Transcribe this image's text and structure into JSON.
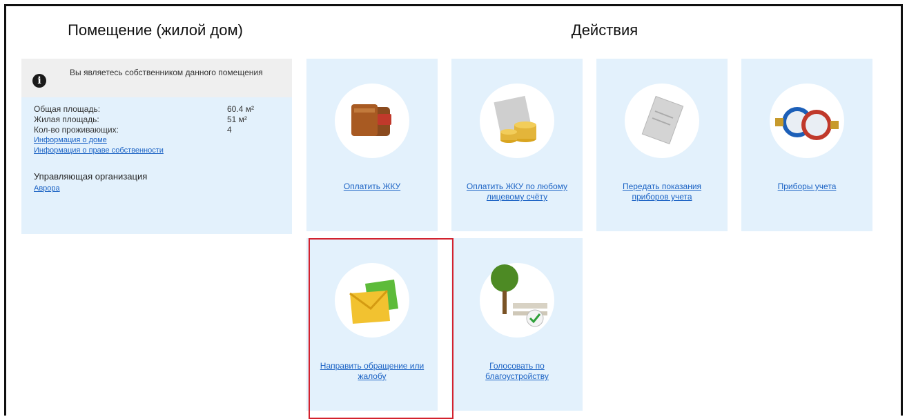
{
  "left_section": {
    "title": "Помещение (жилой дом)",
    "notice": "Вы являетесь собственником данного помещения",
    "properties": [
      {
        "label": "Общая площадь:",
        "value": "60.4 м²"
      },
      {
        "label": "Жилая площадь:",
        "value": "51 м²"
      },
      {
        "label": "Кол-во проживающих:",
        "value": "4"
      }
    ],
    "links": [
      "Информация о доме",
      "Информация о праве собственности"
    ],
    "org_label": "Управляющая организация",
    "org_link": "Аврора"
  },
  "right_section": {
    "title": "Действия",
    "tiles": [
      {
        "label": "Оплатить ЖКУ",
        "icon": "wallet-icon"
      },
      {
        "label": "Оплатить ЖКУ по любому лицевому счёту",
        "icon": "coins-icon"
      },
      {
        "label": "Передать показания приборов учета",
        "icon": "document-icon"
      },
      {
        "label": "Приборы учета",
        "icon": "water-meter-icon"
      },
      {
        "label": "Направить обращение или жалобу",
        "icon": "envelope-icon"
      },
      {
        "label": "Голосовать по благоустройству",
        "icon": "tree-bench-icon"
      }
    ]
  },
  "colors": {
    "tile_bg": "#e3f1fc",
    "link": "#1a62c4",
    "highlight": "#d3222e"
  }
}
